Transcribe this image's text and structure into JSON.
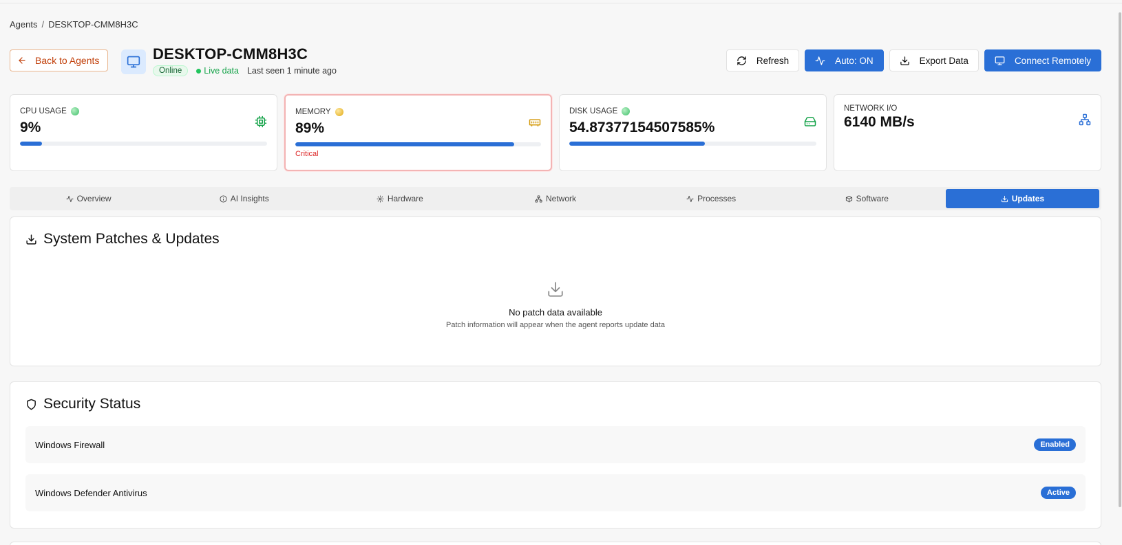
{
  "breadcrumb": {
    "root": "Agents",
    "separator": "/",
    "current": "DESKTOP-CMM8H3C"
  },
  "header": {
    "back_label": "Back to Agents",
    "device_name": "DESKTOP-CMM8H3C",
    "status_badge": "Online",
    "live_label": "Live data",
    "last_seen": "Last seen 1 minute ago",
    "actions": {
      "refresh": "Refresh",
      "auto": "Auto: ON",
      "export": "Export Data",
      "connect": "Connect Remotely"
    }
  },
  "stats": {
    "cpu": {
      "label": "CPU USAGE",
      "value": "9%",
      "percent": 9,
      "status_color": "#3fbf6a",
      "icon": "cpu-icon"
    },
    "memory": {
      "label": "MEMORY",
      "value": "89%",
      "percent": 89,
      "note": "Critical",
      "status_color": "#e0a810",
      "icon": "memory-icon"
    },
    "disk": {
      "label": "DISK USAGE",
      "value": "54.87377154507585%",
      "percent": 54.87377154507585,
      "status_color": "#3fbf6a",
      "icon": "hard-drive-icon"
    },
    "network": {
      "label": "NETWORK I/O",
      "value": "6140 MB/s",
      "icon": "network-icon"
    }
  },
  "tabs": [
    {
      "label": "Overview",
      "icon": "activity-icon"
    },
    {
      "label": "AI Insights",
      "icon": "info-icon"
    },
    {
      "label": "Hardware",
      "icon": "gear-icon"
    },
    {
      "label": "Network",
      "icon": "network-icon"
    },
    {
      "label": "Processes",
      "icon": "activity-icon"
    },
    {
      "label": "Software",
      "icon": "package-icon"
    },
    {
      "label": "Updates",
      "icon": "download-icon",
      "active": true
    }
  ],
  "patches": {
    "title": "System Patches & Updates",
    "empty_title": "No patch data available",
    "empty_subtitle": "Patch information will appear when the agent reports update data"
  },
  "security": {
    "title": "Security Status",
    "items": [
      {
        "label": "Windows Firewall",
        "status": "Enabled"
      },
      {
        "label": "Windows Defender Antivirus",
        "status": "Active"
      }
    ]
  },
  "colors": {
    "accent": "#2a6fd6",
    "critical": "#dc2626",
    "back": "#c2410c",
    "online": "#16a34a"
  }
}
